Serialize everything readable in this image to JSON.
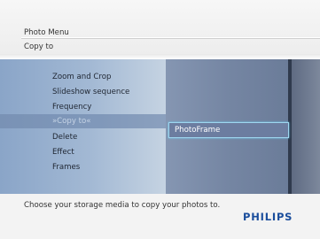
{
  "header": {
    "title": "Photo Menu",
    "subtitle": "Copy to"
  },
  "menu": {
    "items": [
      {
        "label": "Zoom and Crop"
      },
      {
        "label": "Slideshow sequence"
      },
      {
        "label": "Frequency"
      },
      {
        "label": "»Copy to«"
      },
      {
        "label": "Delete"
      },
      {
        "label": "Effect"
      },
      {
        "label": "Frames"
      }
    ],
    "selected_index": 3
  },
  "submenu": {
    "items": [
      {
        "label": "PhotoFrame"
      }
    ]
  },
  "footer": {
    "instruction": "Choose your storage media to copy your photos to.",
    "brand": "PHILIPS"
  },
  "colors": {
    "brand": "#1a4d9c",
    "highlight_border": "#9fd7f0"
  }
}
